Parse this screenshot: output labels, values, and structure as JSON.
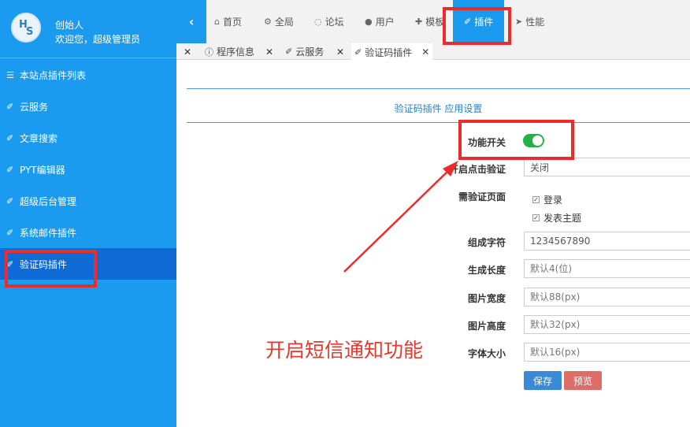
{
  "sidebar": {
    "profile": {
      "name": "创始人",
      "welcome": "欢迎您，超级管理员",
      "avatar_letters": [
        "H",
        "S"
      ]
    },
    "items": [
      {
        "label": "本站点插件列表",
        "icon": "list-icon"
      },
      {
        "label": "云服务",
        "icon": "plug-icon"
      },
      {
        "label": "文章搜索",
        "icon": "plug-icon"
      },
      {
        "label": "PYT编辑器",
        "icon": "plug-icon"
      },
      {
        "label": "超级后台管理",
        "icon": "plug-icon"
      },
      {
        "label": "系统邮件插件",
        "icon": "plug-icon"
      },
      {
        "label": "验证码插件",
        "icon": "plug-icon",
        "active": true
      }
    ]
  },
  "topnav": {
    "toggle_icon": "chevron-left-icon",
    "items": [
      {
        "label": "首页",
        "icon": "home-icon"
      },
      {
        "label": "全局",
        "icon": "cogs-icon"
      },
      {
        "label": "论坛",
        "icon": "comments-icon"
      },
      {
        "label": "用户",
        "icon": "users-icon"
      },
      {
        "label": "模板",
        "icon": "puzzle-icon"
      },
      {
        "label": "插件",
        "icon": "plug-icon",
        "active": true
      },
      {
        "label": "性能",
        "icon": "send-icon"
      }
    ]
  },
  "tabs": [
    {
      "label": "程序信息",
      "icon": "info-icon"
    },
    {
      "label": "云服务",
      "icon": "plug-icon"
    },
    {
      "label": "验证码插件",
      "icon": "plug-icon",
      "active": true
    }
  ],
  "form": {
    "title": "验证码插件 应用设置",
    "switch_label": "功能开关",
    "switch_on": true,
    "click_verify_label": "开启点击验证",
    "click_verify_value": "关闭",
    "pages_label": "需验证页面",
    "pages": [
      {
        "label": "登录",
        "checked": true
      },
      {
        "label": "发表主题",
        "checked": true
      }
    ],
    "charset_label": "组成字符",
    "charset_value": "1234567890",
    "length_label": "生成长度",
    "length_placeholder": "默认4(位)",
    "width_label": "图片宽度",
    "width_placeholder": "默认88(px)",
    "height_label": "图片高度",
    "height_placeholder": "默认32(px)",
    "fontsize_label": "字体大小",
    "fontsize_placeholder": "默认16(px)",
    "save_label": "保存",
    "preview_label": "预览"
  },
  "annotation": {
    "text": "开启短信通知功能",
    "color": "#e23a2f"
  },
  "colors": {
    "sidebar": "#1a9bf0",
    "sidebar_active": "#0f6ad6",
    "accent": "#2d7fc0",
    "switch_on": "#24b14a",
    "highlight": "#ee2b2b"
  }
}
